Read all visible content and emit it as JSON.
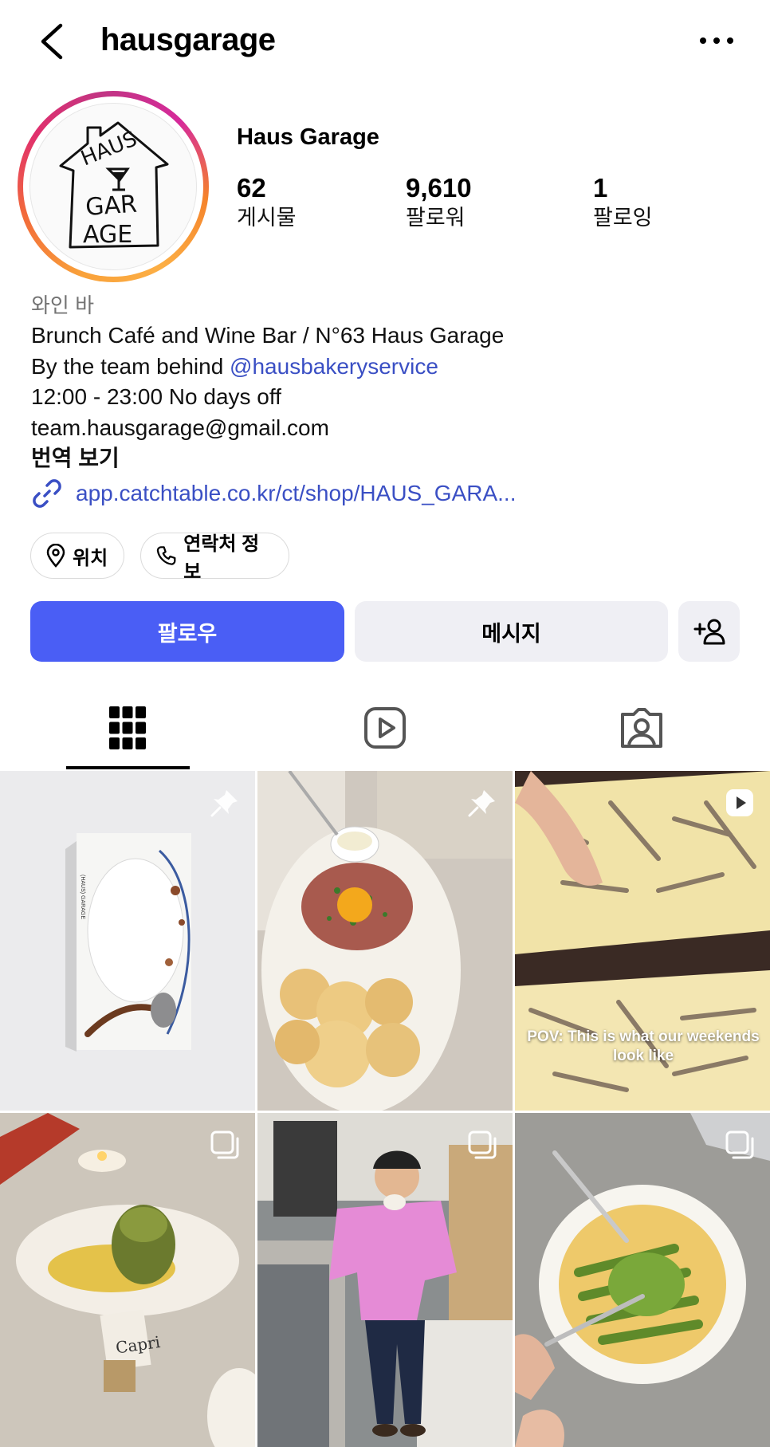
{
  "header": {
    "username": "hausgarage",
    "back_icon": "chevron-left-icon",
    "more_icon": "more-horizontal-icon"
  },
  "profile": {
    "display_name": "Haus Garage",
    "avatar_logo_text": "HAUS GARAGE",
    "stats": [
      {
        "value": "62",
        "label": "게시물"
      },
      {
        "value": "9,610",
        "label": "팔로워"
      },
      {
        "value": "1",
        "label": "팔로잉"
      }
    ]
  },
  "bio": {
    "category": "와인 바",
    "line1": "Brunch Café and Wine Bar / N°63 Haus Garage",
    "line2_prefix": "By the team behind ",
    "line2_mention": "@hausbakeryservice",
    "line3": "12:00 - 23:00 No days off",
    "line4": "team.hausgarage@gmail.com",
    "translate": "번역 보기",
    "link": "app.catchtable.co.kr/ct/shop/HAUS_GARA..."
  },
  "chips": {
    "location": "위치",
    "contact": "연락처 정보"
  },
  "actions": {
    "follow": "팔로우",
    "message": "메시지"
  },
  "tabs": [
    "grid-icon",
    "reels-icon",
    "tagged-icon"
  ],
  "posts": [
    {
      "badge": "pin-icon",
      "caption": ""
    },
    {
      "badge": "pin-icon",
      "caption": ""
    },
    {
      "badge": "reel-icon",
      "caption": "POV: This is what our weekends look like"
    },
    {
      "badge": "carousel-icon",
      "caption": "Capri"
    },
    {
      "badge": "carousel-icon",
      "caption": ""
    },
    {
      "badge": "carousel-icon",
      "caption": ""
    }
  ],
  "colors": {
    "accent": "#4a5ef5",
    "link": "#3a4fc4",
    "secondary_bg": "#efeff4"
  }
}
